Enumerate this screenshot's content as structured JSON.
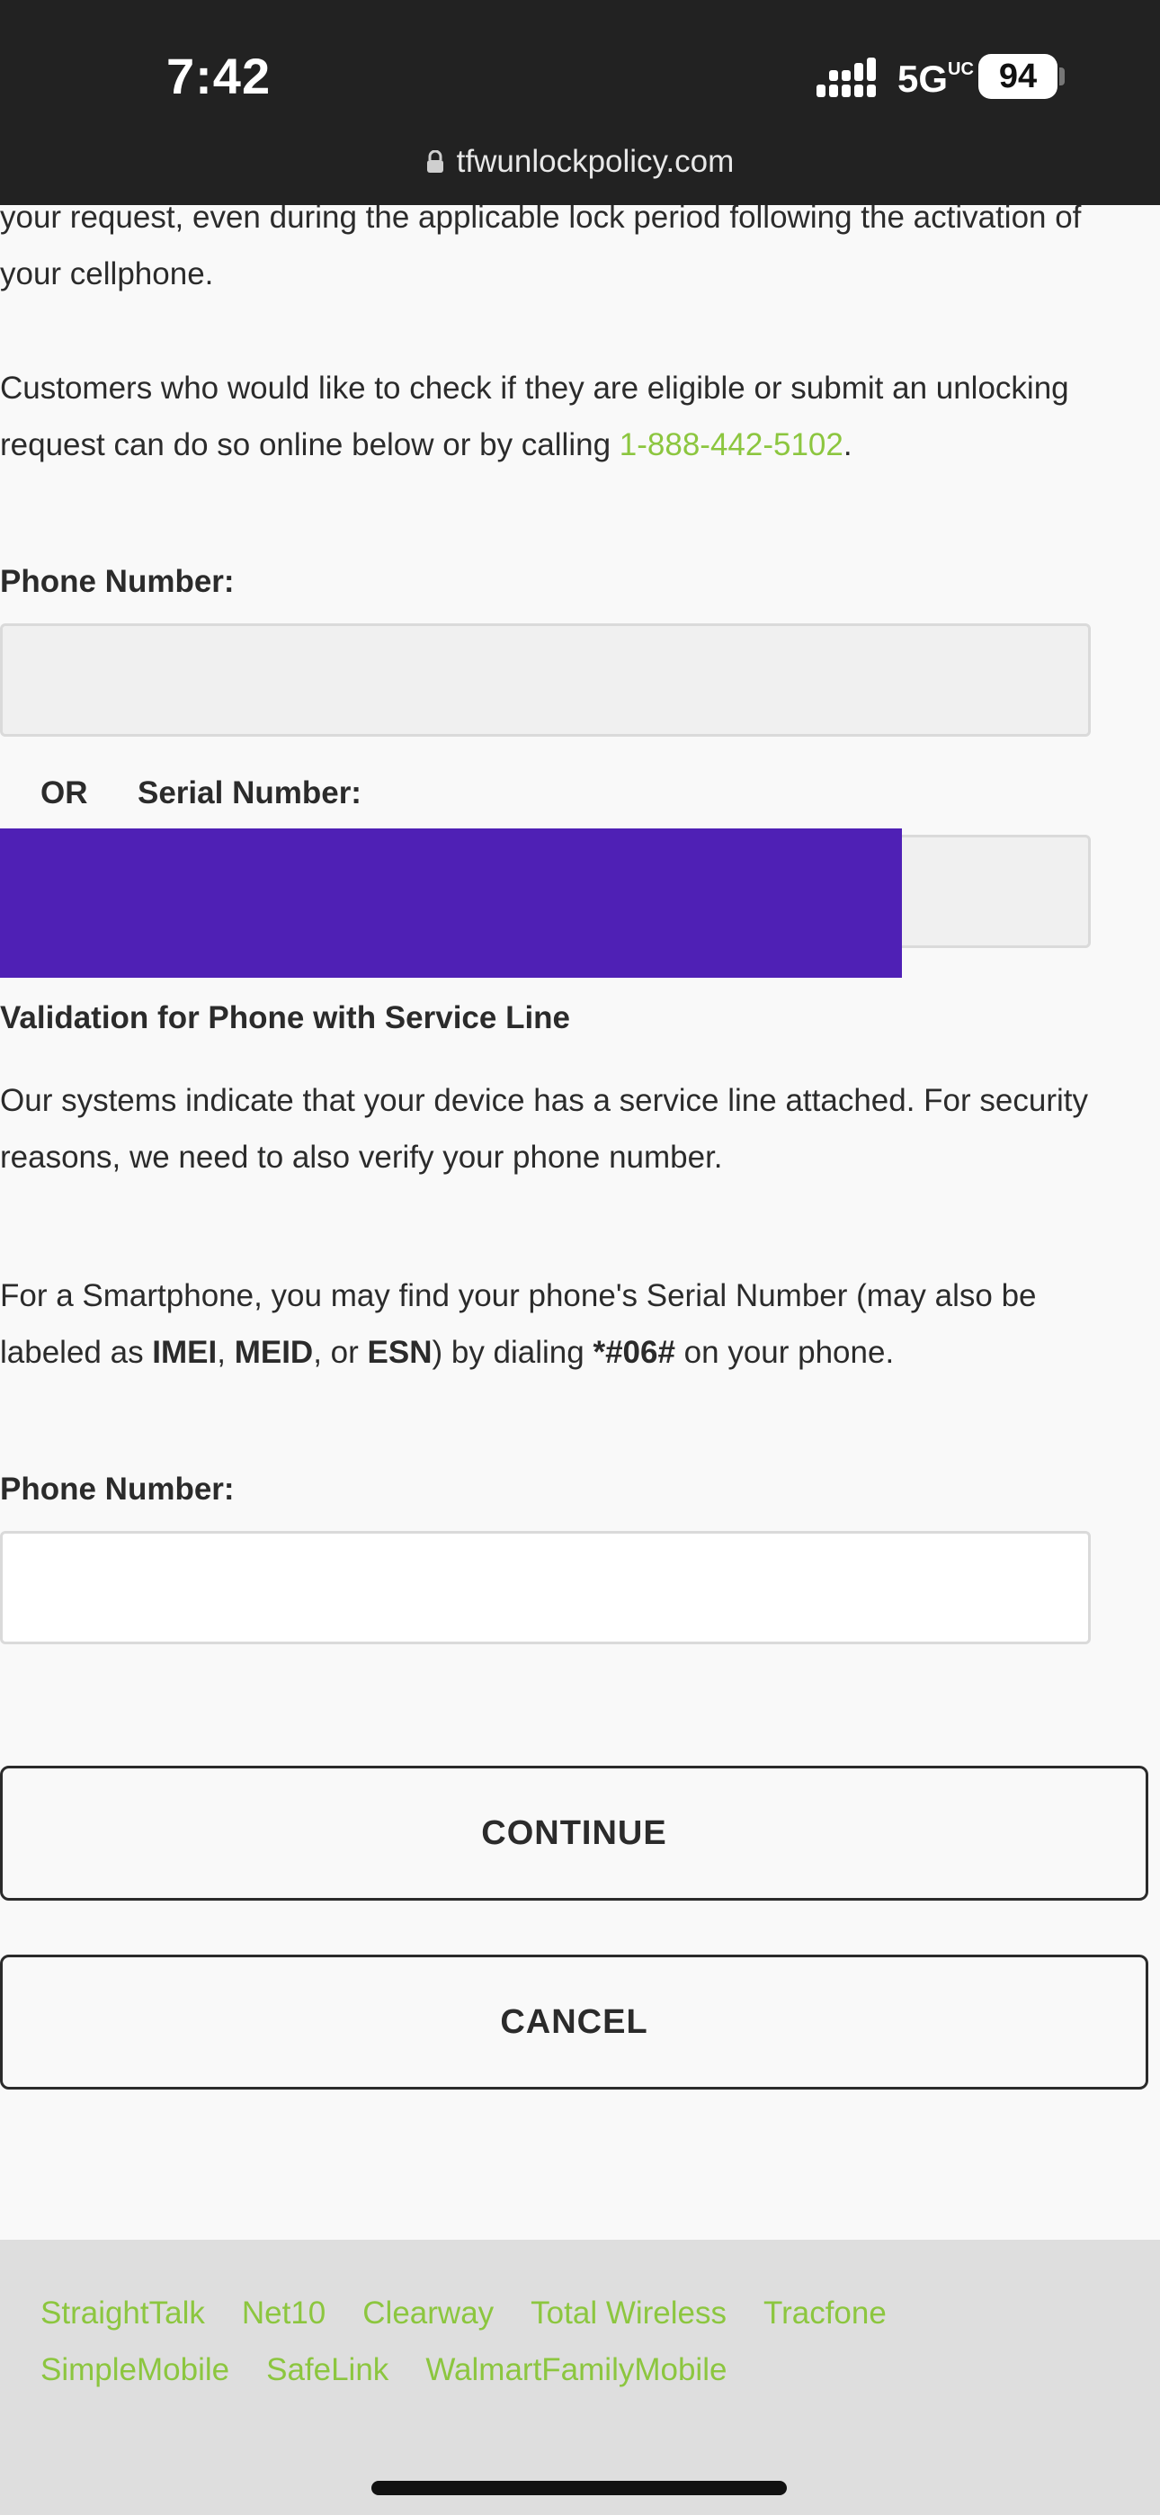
{
  "status_bar": {
    "time": "7:42",
    "network": "5G",
    "network_suffix": "UC",
    "battery": "94"
  },
  "browser": {
    "url": "tfwunlockpolicy.com"
  },
  "intro": {
    "lock_text": "your request, even during the applicable lock period following the activation of your cellphone.",
    "check_text": "Customers who would like to check if they are eligible or submit an unlocking request can do so online below or by calling ",
    "phone_link": "1-888-442-5102",
    "check_end": "."
  },
  "form1": {
    "phone_label": "Phone Number:",
    "phone_value": "",
    "or_label": "OR",
    "serial_label": "Serial Number:",
    "serial_value": ""
  },
  "validation": {
    "heading": "Validation for Phone with Service Line",
    "text": "Our systems indicate that your device has a service line attached. For security reasons, we need to also verify your phone number.",
    "smartphone_a": "For a Smartphone, you may find your phone's Serial Number (may also be labeled as ",
    "imei": "IMEI",
    "comma": ", ",
    "meid": "MEID",
    "or_text": ", or ",
    "esn": "ESN",
    "dial_text": ") by dialing ",
    "code": "*#06#",
    "end_text": " on your phone."
  },
  "form2": {
    "phone_label": "Phone Number:",
    "phone_value": ""
  },
  "buttons": {
    "continue": "CONTINUE",
    "cancel": "CANCEL"
  },
  "footer": {
    "row1": [
      "StraightTalk",
      "Net10",
      "Clearway",
      "Total Wireless",
      "Tracfone"
    ],
    "row2": [
      "SimpleMobile",
      "SafeLink",
      "WalmartFamilyMobile"
    ]
  },
  "colors": {
    "link": "#8cc63f",
    "redaction": "#4f20b5",
    "status_bar": "#222222"
  }
}
